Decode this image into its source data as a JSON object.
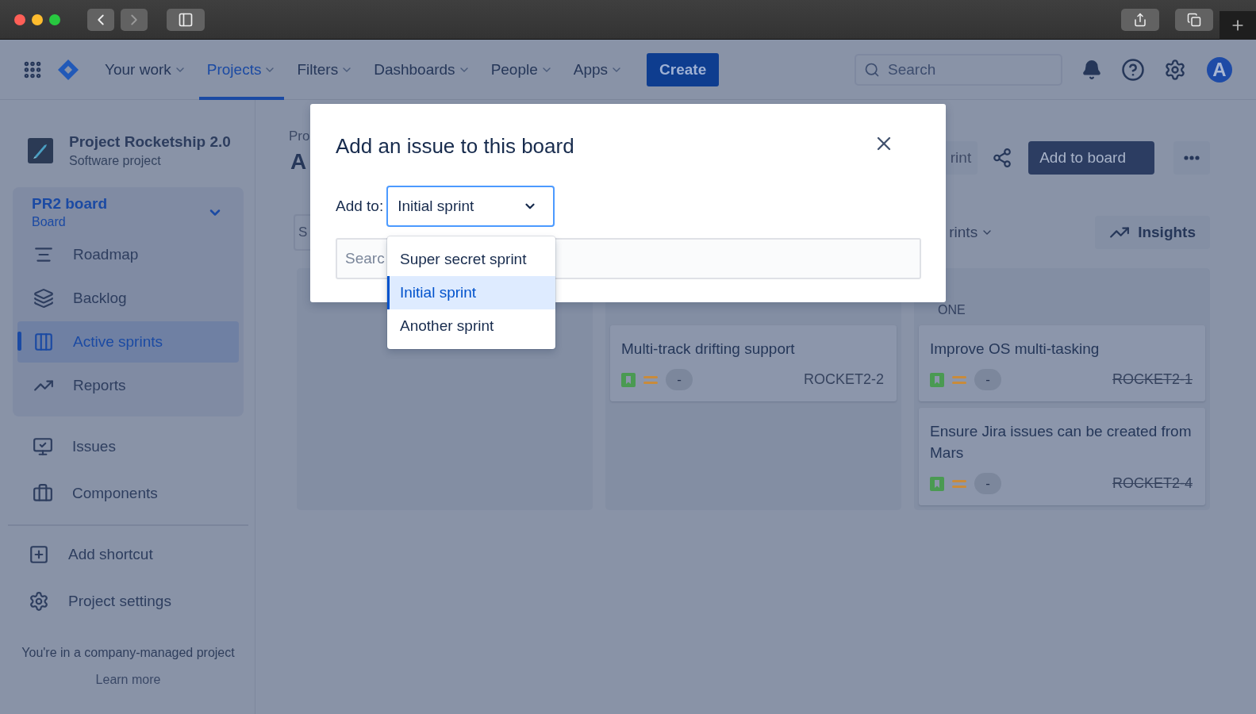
{
  "browser": {
    "nav_buttons": [
      {
        "kind": "back",
        "disabled": false
      },
      {
        "kind": "forward",
        "disabled": true
      }
    ]
  },
  "topnav": {
    "items": [
      {
        "label": "Your work",
        "selected": false
      },
      {
        "label": "Projects",
        "selected": true
      },
      {
        "label": "Filters",
        "selected": false
      },
      {
        "label": "Dashboards",
        "selected": false
      },
      {
        "label": "People",
        "selected": false
      },
      {
        "label": "Apps",
        "selected": false
      }
    ],
    "create": "Create",
    "search": {
      "placeholder": "Search"
    },
    "avatar": "A"
  },
  "sidebar": {
    "project": {
      "name": "Project Rocketship 2.0",
      "type": "Software project"
    },
    "board": {
      "name": "PR2 board",
      "subtitle": "Board",
      "expanded": true
    },
    "board_items": [
      {
        "label": "Roadmap",
        "kind": "roadmap",
        "selected": false
      },
      {
        "label": "Backlog",
        "kind": "backlog",
        "selected": false
      },
      {
        "label": "Active sprints",
        "kind": "sprints",
        "selected": true
      },
      {
        "label": "Reports",
        "kind": "reports",
        "selected": false
      }
    ],
    "items": [
      {
        "label": "Issues",
        "kind": "issues"
      },
      {
        "label": "Components",
        "kind": "components"
      }
    ],
    "shortcuts": [
      {
        "label": "Add shortcut",
        "kind": "add"
      },
      {
        "label": "Project settings",
        "kind": "settings"
      }
    ],
    "footer": {
      "text": "You're in a company-managed project",
      "link": "Learn more"
    }
  },
  "page": {
    "breadcrumb": "Pro",
    "title": "A",
    "sprint_button": "rint",
    "add_button": "Add to board",
    "search_value": "S",
    "sprints_filter": "rints",
    "insights": "Insights",
    "columns": [
      {
        "kind": "empty"
      },
      {
        "kind": "cards",
        "cards": [
          {
            "title": "Multi-track drifting support",
            "estimate": "-",
            "key": "ROCKET2-2",
            "done": false
          }
        ]
      },
      {
        "kind": "cards",
        "heading": "ONE",
        "cards": [
          {
            "title": "Improve OS multi-tasking",
            "estimate": "-",
            "key": "ROCKET2-1",
            "done": true
          },
          {
            "title": "Ensure Jira issues can be created from Mars",
            "estimate": "-",
            "key": "ROCKET2-4",
            "done": true
          }
        ]
      }
    ]
  },
  "dialog": {
    "title": "Add an issue to this board",
    "add_to_label": "Add to:",
    "select_value": "Initial sprint",
    "search_placeholder": "Searc",
    "options": [
      {
        "label": "Super secret sprint",
        "selected": false
      },
      {
        "label": "Initial sprint",
        "selected": true
      },
      {
        "label": "Another sprint",
        "selected": false
      }
    ]
  }
}
